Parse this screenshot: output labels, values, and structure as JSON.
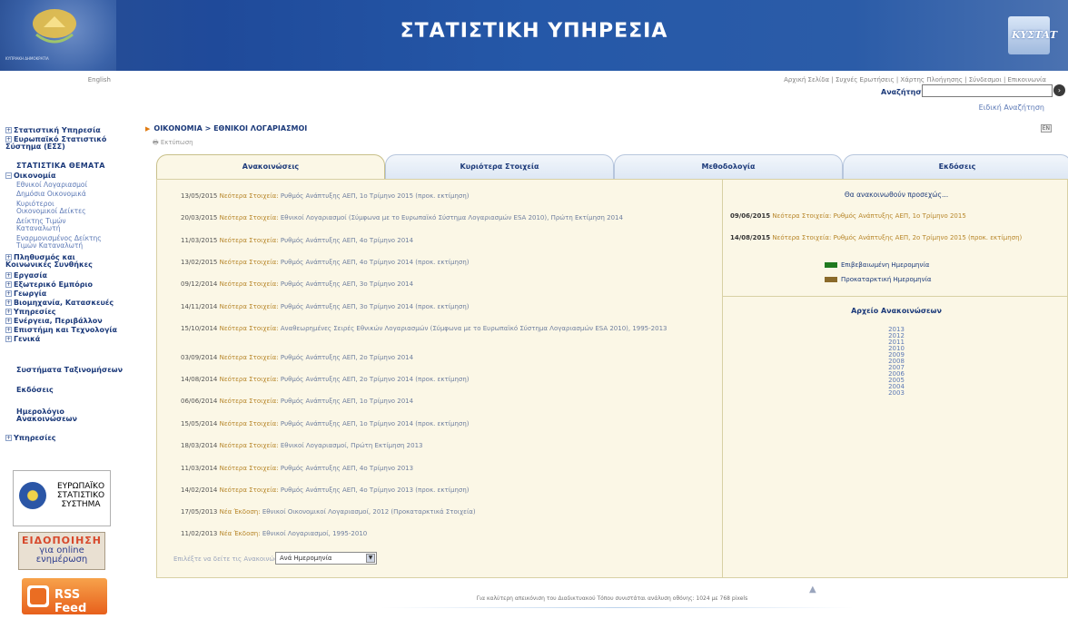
{
  "header": {
    "title": "ΣΤΑΤΙΣΤΙΚΗ ΥΠΗΡΕΣΙΑ",
    "emblem_caption": "ΚΥΠΡΙΑΚΗ ΔΗΜΟΚΡΑΤΙΑ",
    "right_logo_text": "ΚΥΣΤΑΤ"
  },
  "sidebar": {
    "language": "English",
    "items": [
      {
        "label": "Στατιστική Υπηρεσία",
        "marker": "+"
      },
      {
        "label": "Ευρωπαϊκό Στατιστικό Σύστημα (ΕΣΣ)",
        "marker": "+"
      }
    ],
    "themes_heading": "ΣΤΑΤΙΣΤΙΚΑ ΘΕΜΑΤΑ",
    "economy": {
      "label": "Οικονομία",
      "marker": "−"
    },
    "economy_sub": [
      "Εθνικοί Λογαριασμοί",
      "Δημόσια Οικονομικά",
      "Κυριότεροι Οικονομικοί Δείκτες",
      "Δείκτης Τιμών Καταναλωτή",
      "Εναρμονισμένος Δείκτης Τιμών Καταναλωτή"
    ],
    "more_items": [
      {
        "label": "Πληθυσμός και Κοινωνικές Συνθήκες",
        "marker": "+"
      },
      {
        "label": "Εργασία",
        "marker": "+"
      },
      {
        "label": "Εξωτερικό Εμπόριο",
        "marker": "+"
      },
      {
        "label": "Γεωργία",
        "marker": "+"
      },
      {
        "label": "Βιομηχανία, Κατασκευές",
        "marker": "+"
      },
      {
        "label": "Υπηρεσίες",
        "marker": "+"
      },
      {
        "label": "Ενέργεια, Περιβάλλον",
        "marker": "+"
      },
      {
        "label": "Επιστήμη και Τεχνολογία",
        "marker": "+"
      },
      {
        "label": "Γενικά",
        "marker": "+"
      }
    ],
    "links": [
      "Συστήματα Ταξινομήσεων",
      "Εκδόσεις",
      "Ημερολόγιο Ανακοινώσεων"
    ],
    "services": {
      "label": "Υπηρεσίες",
      "marker": "+"
    },
    "eu_text": "ΕΥΡΩΠΑΪΚΟ ΣΤΑΤΙΣΤΙΚΟ ΣΥΣΤΗΜΑ",
    "notify_title": "ΕΙΔΟΠΟΙΗΣΗ",
    "notify_sub": "για online ενημέρωση",
    "rss_label": "RSS Feed"
  },
  "top": {
    "util_links": "Αρχική Σελίδα | Συχνές Ερωτήσεις | Χάρτης Πλοήγησης | Σύνδεσμοι | Επικοινωνία",
    "search_label": "Αναζήτηση:",
    "search_value": "",
    "advanced_search": "Ειδική Αναζήτηση",
    "en_badge": "EN"
  },
  "breadcrumb": "ΟΙΚΟΝΟΜΙΑ > ΕΘΝΙΚΟΙ ΛΟΓΑΡΙΑΣΜΟΙ",
  "print_label": "Εκτύπωση",
  "tabs": [
    "Ανακοινώσεις",
    "Κυριότερα Στοιχεία",
    "Μεθοδολογία",
    "Εκδόσεις"
  ],
  "announcements": [
    {
      "date": "13/05/2015",
      "tag": "Νεότερα Στοιχεία:",
      "text": "Ρυθμός Ανάπτυξης ΑΕΠ, 1ο Τρίμηνο 2015 (προκ. εκτίμηση)"
    },
    {
      "date": "20/03/2015",
      "tag": "Νεότερα Στοιχεία:",
      "text": "Εθνικοί Λογαριασμοί (Σύμφωνα με το Ευρωπαϊκό Σύστημα Λογαριασμών ESA 2010), Πρώτη Εκτίμηση 2014"
    },
    {
      "date": "11/03/2015",
      "tag": "Νεότερα Στοιχεία:",
      "text": "Ρυθμός Ανάπτυξης ΑΕΠ, 4ο Τρίμηνο 2014"
    },
    {
      "date": "13/02/2015",
      "tag": "Νεότερα Στοιχεία:",
      "text": "Ρυθμός Ανάπτυξης ΑΕΠ, 4ο Τρίμηνο 2014 (προκ. εκτίμηση)"
    },
    {
      "date": "09/12/2014",
      "tag": "Νεότερα Στοιχεία:",
      "text": "Ρυθμός Ανάπτυξης ΑΕΠ, 3ο Τρίμηνο 2014"
    },
    {
      "date": "14/11/2014",
      "tag": "Νεότερα Στοιχεία:",
      "text": "Ρυθμός Ανάπτυξης ΑΕΠ, 3ο Τρίμηνο 2014 (προκ. εκτίμηση)"
    },
    {
      "date": "15/10/2014",
      "tag": "Νεότερα Στοιχεία:",
      "text": "Αναθεωρημένες Σειρές Εθνικών Λογαριασμών (Σύμφωνα με το Ευρωπαϊκό Σύστημα Λογαριασμών ESA 2010), 1995-2013"
    },
    {
      "date": "03/09/2014",
      "tag": "Νεότερα Στοιχεία:",
      "text": "Ρυθμός Ανάπτυξης ΑΕΠ, 2ο Τρίμηνο 2014"
    },
    {
      "date": "14/08/2014",
      "tag": "Νεότερα Στοιχεία:",
      "text": "Ρυθμός Ανάπτυξης ΑΕΠ, 2ο Τρίμηνο 2014 (προκ. εκτίμηση)"
    },
    {
      "date": "06/06/2014",
      "tag": "Νεότερα Στοιχεία:",
      "text": "Ρυθμός Ανάπτυξης ΑΕΠ, 1ο Τρίμηνο 2014"
    },
    {
      "date": "15/05/2014",
      "tag": "Νεότερα Στοιχεία:",
      "text": "Ρυθμός Ανάπτυξης ΑΕΠ, 1ο Τρίμηνο 2014 (προκ. εκτίμηση)"
    },
    {
      "date": "18/03/2014",
      "tag": "Νεότερα Στοιχεία:",
      "text": "Εθνικοί Λογαριασμοί, Πρώτη Εκτίμηση 2013"
    },
    {
      "date": "11/03/2014",
      "tag": "Νεότερα Στοιχεία:",
      "text": "Ρυθμός Ανάπτυξης ΑΕΠ, 4ο Τρίμηνο 2013"
    },
    {
      "date": "14/02/2014",
      "tag": "Νεότερα Στοιχεία:",
      "text": "Ρυθμός Ανάπτυξης ΑΕΠ, 4ο Τρίμηνο 2013 (προκ. εκτίμηση)"
    },
    {
      "date": "17/05/2013",
      "tag": "Νέα Έκδοση:",
      "text": "Εθνικοί Οικονομικοί Λογαριασμοί, 2012 (Προκαταρκτικά Στοιχεία)"
    },
    {
      "date": "11/02/2013",
      "tag": "Νέα Έκδοση:",
      "text": "Εθνικοί Λογαριασμοί, 1995-2010"
    }
  ],
  "upcoming": {
    "title": "Θα ανακοινωθούν προσεχώς...",
    "items": [
      {
        "date": "09/06/2015",
        "tag": "Νεότερα Στοιχεία:",
        "text": "Ρυθμός Ανάπτυξης ΑΕΠ, 1ο Τρίμηνο 2015"
      },
      {
        "date": "14/08/2015",
        "tag": "Νεότερα Στοιχεία:",
        "text": "Ρυθμός Ανάπτυξης ΑΕΠ, 2ο Τρίμηνο 2015 (προκ. εκτίμηση)"
      }
    ],
    "legend": [
      {
        "label": "Επιβεβαιωμένη Ημερομηνία",
        "color": "#1f7a1f"
      },
      {
        "label": "Προκαταρκτική Ημερομηνία",
        "color": "#8a6a2a"
      }
    ]
  },
  "archive": {
    "title": "Αρχείο Ανακοινώσεων",
    "years": [
      "2013",
      "2012",
      "2011",
      "2010",
      "2009",
      "2008",
      "2007",
      "2006",
      "2005",
      "2004",
      "2003"
    ]
  },
  "filter": {
    "label": "Επιλέξτε να δείτε τις Ανακοινώσεις",
    "selected": "Ανά Ημερομηνία"
  },
  "footer_note": "Για καλύτερη απεικόνιση του Διαδικτυακού Τόπου συνιστάται ανάλυση οθόνης: 1024 με 768 pixels",
  "colors": {
    "banner": "#2558a8",
    "panel": "#fbf7e6",
    "link": "#5b78b5",
    "gold": "#b7862a"
  }
}
